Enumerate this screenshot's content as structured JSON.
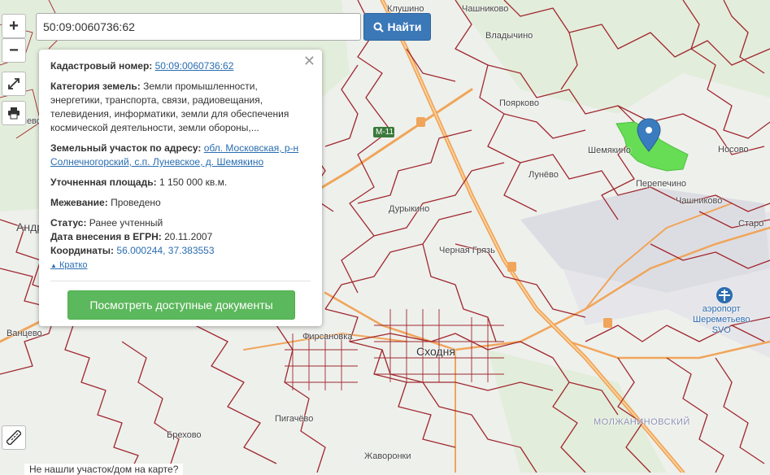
{
  "search": {
    "value": "50:09:0060736:62",
    "button_label": "Найти"
  },
  "controls": {
    "zoom_in": "+",
    "zoom_out": "−"
  },
  "popup": {
    "cadastral_label": "Кадастровый номер:",
    "cadastral_value": "50:09:0060736:62",
    "category_label": "Категория земель:",
    "category_value": "Земли промышленности, энергетики, транспорта, связи, радиовещания, телевидения, информатики, земли для обеспечения космической деятельности, земли обороны,...",
    "address_label": "Земельный участок по адресу:",
    "address_value": "обл. Московская, р-н Солнечногорский, с.п. Луневское, д. Шемякино",
    "area_label": "Уточненная площадь:",
    "area_value": "1 150 000 кв.м.",
    "survey_label": "Межевание:",
    "survey_value": "Проведено",
    "status_label": "Статус:",
    "status_value": "Ранее учтенный",
    "egrn_label": "Дата внесения в ЕГРН:",
    "egrn_value": "20.11.2007",
    "coords_label": "Координаты:",
    "coords_value": "56.000244, 37.383553",
    "collapse_label": "Кратко",
    "docs_button": "Посмотреть доступные документы"
  },
  "map_labels": {
    "chashnikovo_top": "Чашниково",
    "klushino": "Клушино",
    "vladychino": "Владычино",
    "poyarkovo": "Поярково",
    "shemyakino": "Шемякино",
    "nosovo": "Носово",
    "lunevo": "Лунёво",
    "perepechino": "Перепечино",
    "chashnikovo": "Чашниково",
    "m11": "М-11",
    "durykino": "Дурыкино",
    "chernaya_gryaz": "Черная Грязь",
    "skhodnya": "Сходня",
    "firsanovka": "Фирсановка",
    "pigachevo": "Пигачёво",
    "brekhovo": "Брехово",
    "zhavoronki": "Жаворонки",
    "molzhaninovsky": "МОЛЖАНИНОВСКИЙ",
    "airport_line1": "аэропорт",
    "airport_line2": "Шереметьево",
    "airport_line3": "SVO",
    "andreevka": "Андр",
    "vanteevo": "Ванцево",
    "sheshevo": "ешево",
    "starayaA": "Старо"
  },
  "bottom_note": "Не нашли участок/дом на карте?",
  "colors": {
    "parcel_border": "#a0282e",
    "highlight_parcel": "#66dd55",
    "marker": "#3a7cbf",
    "search_button": "#3a78b8",
    "docs_button": "#5cb85c",
    "link": "#2a6db0"
  },
  "icons": [
    "search-icon",
    "expand-icon",
    "print-icon",
    "ruler-icon",
    "close-icon",
    "location-marker-icon",
    "airport-icon",
    "chevron-up-icon"
  ]
}
